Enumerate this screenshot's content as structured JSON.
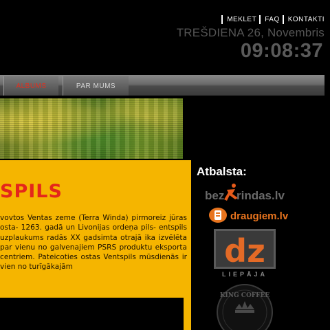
{
  "topnav": {
    "items": [
      "MEKLET",
      "FAQ",
      "KONTAKTI"
    ]
  },
  "datetime": {
    "date": "TREŠDIENA 26, Novembris",
    "time": "09:08:37"
  },
  "nav": {
    "tabs": [
      "ALBUMS",
      "PAR MUMS"
    ],
    "active_color": "#e03020"
  },
  "content": {
    "heading": "SPILS",
    "paragraph": "vovtos Ventas zeme (Terra Winda) pirmoreiz jūras osta- 1263. gadā un Livonijas ordeņa pils- entspils uzplaukums radās XX gadsimta otrajā ika izvēlēta par vienu no galvenajiem PSRS produktu eksporta centriem. Pateicoties ostas Ventspils mūsdienās ir vien no turīgākajām",
    "background_color": "#f5b500",
    "heading_color": "#e4261b"
  },
  "sponsors": {
    "title": "Atbalsta:",
    "logos": [
      {
        "text": "bezrindas.lv",
        "icon": "runner-icon"
      },
      {
        "text": "draugiem.lv",
        "icon": "draugiem-icon"
      },
      {
        "text": "dz",
        "subtitle": "LIEPĀJA"
      },
      {
        "text": "KING COFFEE"
      }
    ]
  }
}
